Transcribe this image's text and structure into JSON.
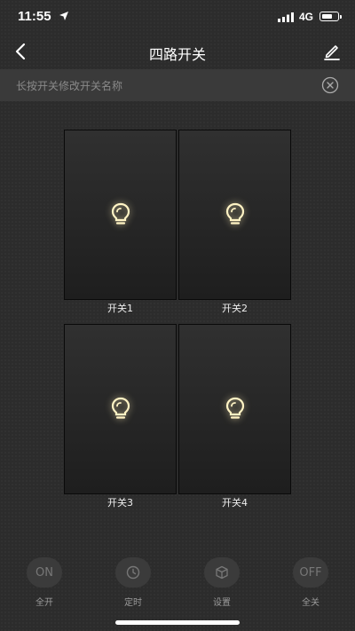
{
  "status_bar": {
    "time": "11:55",
    "network": "4G"
  },
  "nav": {
    "title": "四路开关"
  },
  "hint": {
    "text": "长按开关修改开关名称"
  },
  "switches": [
    {
      "label": "开关1"
    },
    {
      "label": "开关2"
    },
    {
      "label": "开关3"
    },
    {
      "label": "开关4"
    }
  ],
  "toolbar": {
    "all_on": {
      "icon_text": "ON",
      "label": "全开"
    },
    "timer": {
      "label": "定时"
    },
    "settings": {
      "label": "设置"
    },
    "all_off": {
      "icon_text": "OFF",
      "label": "全关"
    }
  },
  "colors": {
    "bulb_glow": "#fff3c4",
    "background": "#2c2c2c",
    "hint_bar": "#3a3a3a"
  }
}
